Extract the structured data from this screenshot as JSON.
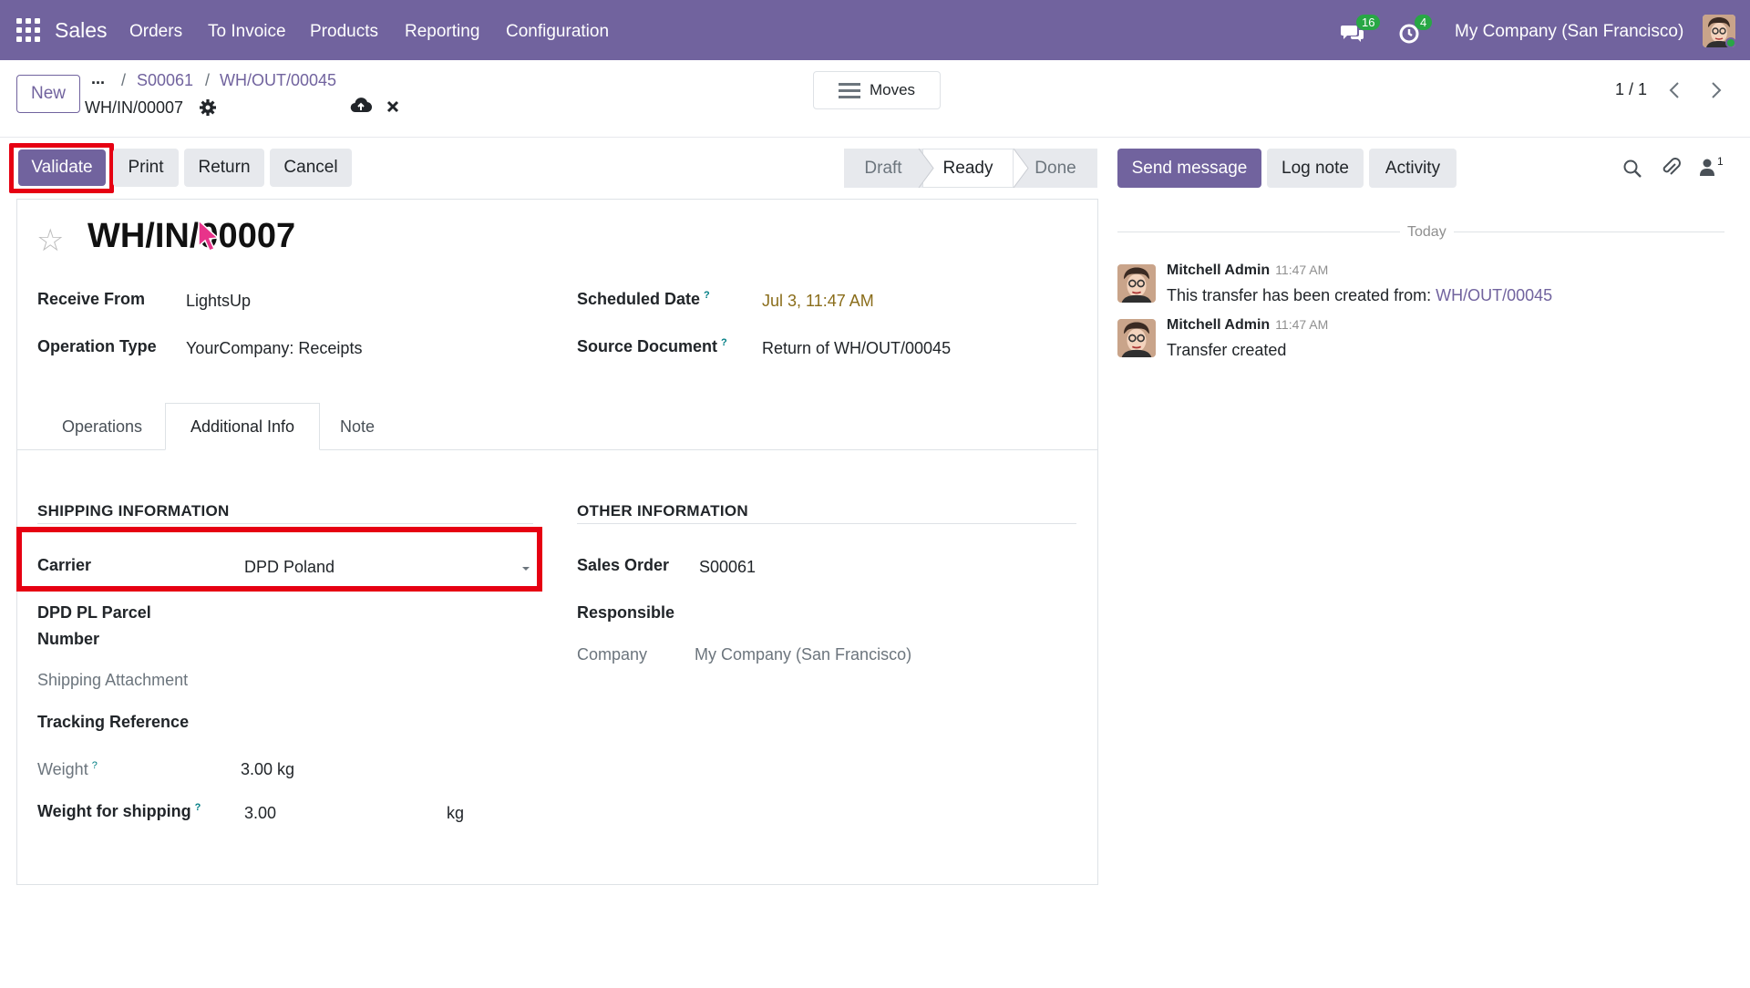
{
  "navbar": {
    "app_name": "Sales",
    "menu": [
      "Orders",
      "To Invoice",
      "Products",
      "Reporting",
      "Configuration"
    ],
    "messages_count": "16",
    "activities_count": "4",
    "company": "My Company (San Francisco)"
  },
  "control_panel": {
    "new_label": "New",
    "more_label": "...",
    "breadcrumbs": [
      "S00061",
      "WH/OUT/00045"
    ],
    "record_name": "WH/IN/00007",
    "moves_label": "Moves",
    "pager": "1 / 1"
  },
  "actions": {
    "validate": "Validate",
    "print": "Print",
    "return": "Return",
    "cancel": "Cancel"
  },
  "status": {
    "steps": [
      "Draft",
      "Ready",
      "Done"
    ],
    "active": "Ready"
  },
  "form": {
    "title": "WH/IN/00007",
    "receive_from_label": "Receive From",
    "receive_from": "LightsUp",
    "operation_type_label": "Operation Type",
    "operation_type": "YourCompany: Receipts",
    "scheduled_date_label": "Scheduled Date",
    "scheduled_date": "Jul 3, 11:47 AM",
    "source_document_label": "Source Document",
    "source_document": "Return of WH/OUT/00045",
    "help_mark": "?",
    "tabs": [
      "Operations",
      "Additional Info",
      "Note"
    ],
    "active_tab": "Additional Info"
  },
  "shipping": {
    "section": "SHIPPING INFORMATION",
    "carrier_label": "Carrier",
    "carrier": "DPD Poland",
    "parcel_label_1": "DPD PL Parcel",
    "parcel_label_2": "Number",
    "attachment_label": "Shipping Attachment",
    "tracking_label": "Tracking Reference",
    "weight_label": "Weight",
    "weight": "3.00 kg",
    "weight_shipping_label": "Weight for shipping",
    "weight_shipping": "3.00",
    "weight_unit": "kg"
  },
  "other": {
    "section": "OTHER INFORMATION",
    "sales_order_label": "Sales Order",
    "sales_order": "S00061",
    "responsible_label": "Responsible",
    "company_label": "Company",
    "company": "My Company (San Francisco)"
  },
  "chatter": {
    "send_message": "Send message",
    "log_note": "Log note",
    "activity": "Activity",
    "followers_count": "1",
    "today": "Today",
    "messages": [
      {
        "author": "Mitchell Admin",
        "time": "11:47 AM",
        "body": "This transfer has been created from:",
        "link": "WH/OUT/00045"
      },
      {
        "author": "Mitchell Admin",
        "time": "11:47 AM",
        "body": "Transfer created",
        "link": ""
      }
    ]
  },
  "colors": {
    "brand": "#71639e",
    "highlight": "#e60012",
    "date": "#8a6d1a"
  }
}
